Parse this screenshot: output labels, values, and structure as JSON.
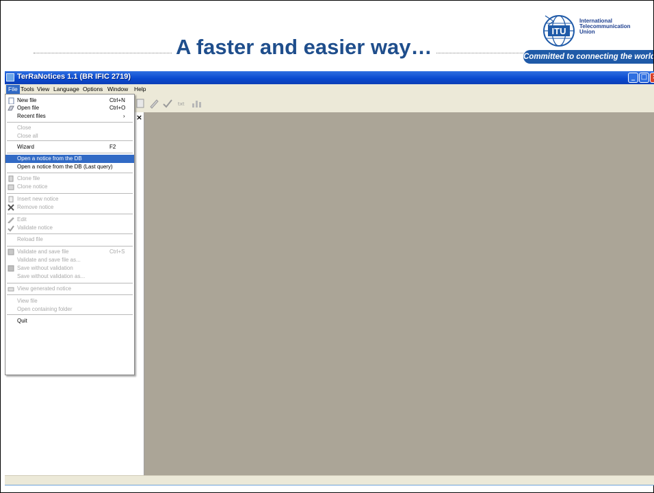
{
  "slide": {
    "title": "A faster and easier way…",
    "logo": {
      "line1": "International",
      "line2": "Telecommunication",
      "line3": "Union",
      "monogram": "ITU",
      "tagline": "Committed to connecting the world"
    }
  },
  "window": {
    "title": "TerRaNotices 1.1 (BR IFIC 2719)"
  },
  "menubar": [
    "File",
    "Tools",
    "View",
    "Language",
    "Options",
    "Window",
    "Help"
  ],
  "file_menu": [
    {
      "label": "New file",
      "shortcut": "Ctrl+N",
      "state": "enabled",
      "icon": "new-file-icon"
    },
    {
      "label": "Open file",
      "shortcut": "Ctrl+O",
      "state": "enabled",
      "icon": "open-file-icon"
    },
    {
      "label": "Recent files",
      "shortcut": "›",
      "state": "enabled"
    },
    {
      "label": "Close",
      "state": "disabled"
    },
    {
      "label": "Close all",
      "state": "disabled"
    },
    {
      "label": "Wizard",
      "shortcut": "F2",
      "state": "enabled"
    },
    {
      "label": "Open a notice from the DB",
      "state": "highlighted"
    },
    {
      "label": "Open a notice from the DB (Last query)",
      "state": "enabled"
    },
    {
      "label": "Clone file",
      "state": "disabled",
      "icon": "clone-file-icon"
    },
    {
      "label": "Clone notice",
      "state": "disabled",
      "icon": "clone-notice-icon"
    },
    {
      "label": "Insert new notice",
      "state": "disabled",
      "icon": "insert-notice-icon"
    },
    {
      "label": "Remove notice",
      "state": "disabled",
      "icon": "remove-notice-icon"
    },
    {
      "label": "Edit",
      "state": "disabled",
      "icon": "edit-icon"
    },
    {
      "label": "Validate notice",
      "state": "disabled",
      "icon": "validate-notice-icon"
    },
    {
      "label": "Reload file",
      "state": "disabled"
    },
    {
      "label": "Validate and save file",
      "shortcut": "Ctrl+S",
      "state": "disabled",
      "icon": "validate-save-icon"
    },
    {
      "label": "Validate and save file as...",
      "state": "disabled"
    },
    {
      "label": "Save without validation",
      "state": "disabled",
      "icon": "save-icon"
    },
    {
      "label": "Save without validation as...",
      "state": "disabled"
    },
    {
      "label": "View generated notice",
      "state": "disabled",
      "icon": "view-notice-icon"
    },
    {
      "label": "View file",
      "state": "disabled"
    },
    {
      "label": "Open containing folder",
      "state": "disabled"
    },
    {
      "label": "Quit",
      "state": "enabled"
    }
  ],
  "pane_close": "×",
  "colors": {
    "title_blue": "#1f4e8c",
    "menu_highlight": "#316ac5",
    "workspace": "#aba597",
    "titlebar": "#0a4ad0"
  }
}
